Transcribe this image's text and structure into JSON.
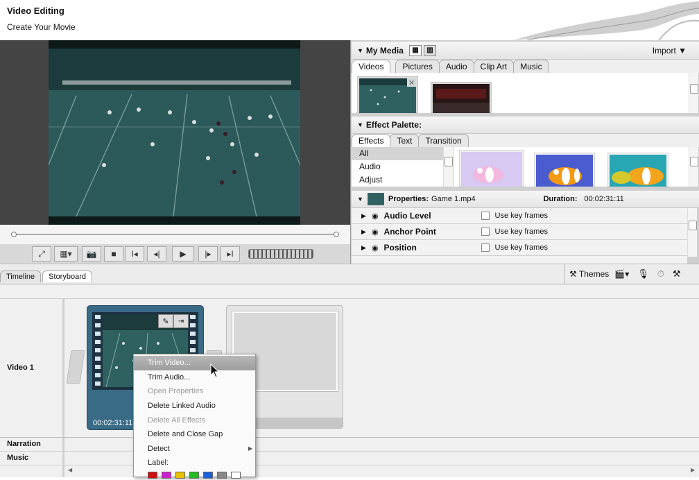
{
  "header": {
    "title": "Video Editing",
    "subtitle": "Create Your Movie"
  },
  "preview": {
    "toolbar_icons": [
      "resize-icon",
      "view-mode-icon",
      "camera-icon",
      "stop-icon",
      "mark-in-icon",
      "prev-frame-icon",
      "play-icon",
      "next-frame-icon",
      "mark-out-icon"
    ]
  },
  "my_media": {
    "title": "My Media",
    "import_label": "Import",
    "tabs": [
      "Videos",
      "Pictures",
      "Audio",
      "Clip Art",
      "Music"
    ],
    "active_tab": "Videos"
  },
  "effect_palette": {
    "title": "Effect Palette:",
    "tabs": [
      "Effects",
      "Text",
      "Transition"
    ],
    "active_tab": "Effects",
    "categories": [
      "All",
      "Audio",
      "Adjust"
    ],
    "selected_category": "All"
  },
  "properties": {
    "label": "Properties:",
    "file": "Game 1.mp4",
    "duration_label": "Duration:",
    "duration": "00:02:31:11",
    "rows": [
      {
        "name": "Audio Level",
        "keyframes": "Use key frames"
      },
      {
        "name": "Anchor Point",
        "keyframes": "Use key frames"
      },
      {
        "name": "Position",
        "keyframes": "Use key frames"
      }
    ]
  },
  "timeline": {
    "tabs": [
      "Timeline",
      "Storyboard"
    ],
    "active_tab": "Storyboard",
    "themes_label": "Themes",
    "tracks": {
      "video": "Video 1",
      "narration": "Narration",
      "music": "Music"
    },
    "clip_duration": "00:02:31:11"
  },
  "context_menu": {
    "items": [
      {
        "label": "Trim Video...",
        "state": "highlighted"
      },
      {
        "label": "Trim Audio...",
        "state": "enabled"
      },
      {
        "label": "Open Properties",
        "state": "disabled"
      },
      {
        "label": "Delete Linked Audio",
        "state": "enabled"
      },
      {
        "label": "Delete All Effects",
        "state": "disabled"
      },
      {
        "label": "Delete and Close Gap",
        "state": "enabled"
      },
      {
        "label": "Detect",
        "state": "enabled"
      },
      {
        "label": "Label:",
        "state": "enabled"
      }
    ],
    "label_colors": [
      "#cc1111",
      "#cc22cc",
      "#e8c000",
      "#22bb22",
      "#1d5fd6",
      "#888888",
      "#ffffff"
    ]
  }
}
